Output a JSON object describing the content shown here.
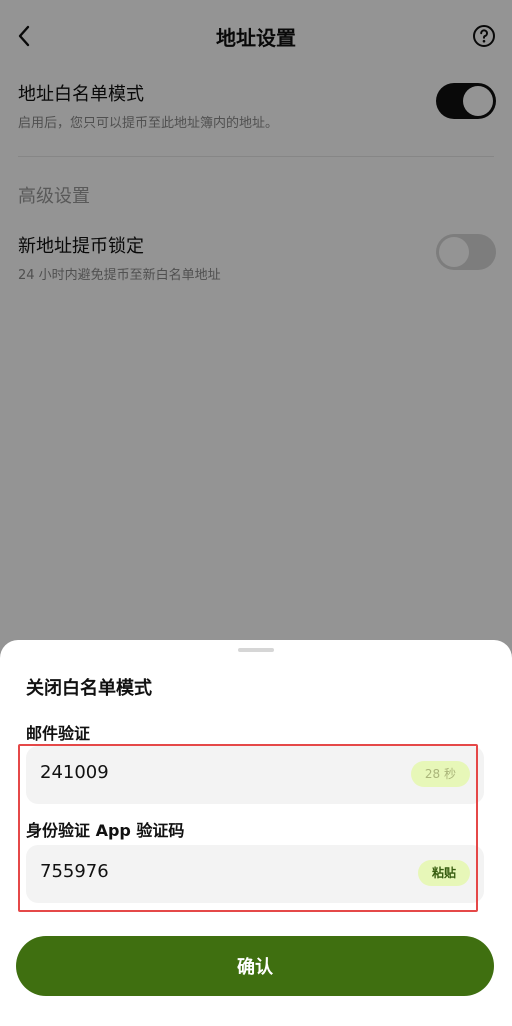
{
  "header": {
    "title": "地址设置",
    "back_icon": "chevron-left-icon",
    "help_icon": "question-circle-icon"
  },
  "settings": {
    "whitelist": {
      "title": "地址白名单模式",
      "description": "启用后，您只可以提币至此地址簿内的地址。",
      "enabled": true
    },
    "advanced_label": "高级设置",
    "new_address_lock": {
      "title": "新地址提币锁定",
      "description": "24 小时内避免提币至新白名单地址",
      "enabled": false
    }
  },
  "sheet": {
    "title": "关闭白名单模式",
    "email": {
      "label": "邮件验证",
      "value": "241009",
      "countdown": "28 秒"
    },
    "authenticator": {
      "label": "身份验证 App 验证码",
      "value": "755976",
      "paste_label": "粘贴"
    },
    "confirm_label": "确认"
  },
  "colors": {
    "primary_green": "#3f6f10",
    "pill_bg": "#e7f7b8",
    "highlight_red": "#e54848"
  }
}
